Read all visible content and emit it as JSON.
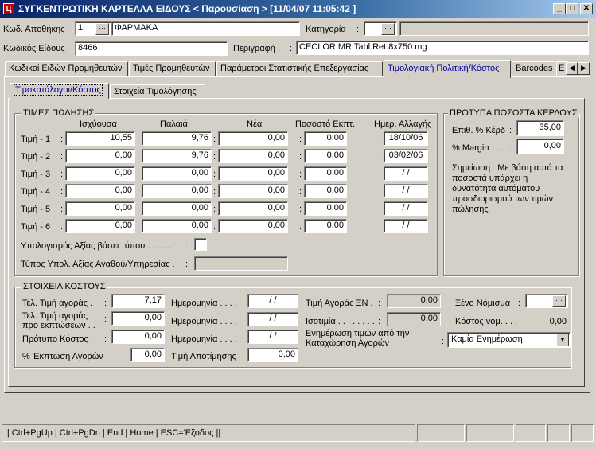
{
  "window": {
    "title": "ΣΥΓΚΕΝΤΡΩΤΙΚΗ ΚΑΡΤΕΛΛΑ ΕΙΔΟΥΣ < Παρουσίαση >   [11/04/07 11:05:42  ]",
    "minimize": "_",
    "maximize": "□",
    "close": "✕"
  },
  "header": {
    "warehouse_label": "Κωδ. Αποθήκης",
    "warehouse_code": "1",
    "warehouse_name": "ΦΑΡΜΑΚΑ",
    "category_label": "Κατηγορία",
    "category_value": "",
    "item_code_label": "Κωδικός Είδους",
    "item_code": "8466",
    "description_label": "Περιγραφή .",
    "description": "CECLOR MR Tabl.Ret.8x750 mg",
    "colon": ":"
  },
  "tabs": [
    {
      "label": "Κωδικοί Ειδών Προμηθευτών"
    },
    {
      "label": "Τιμές Προμηθευτών"
    },
    {
      "label": "Παράμετροι Στατιστικής Επεξεργασίας"
    },
    {
      "label": "Τιμολογιακή Πολιτική/Κόστος"
    },
    {
      "label": "Barcodes"
    },
    {
      "label": "E"
    }
  ],
  "subtabs": [
    {
      "label": "Τιμοκατάλογοι/Κόστος"
    },
    {
      "label": "Στοιχεία Τιμολόγησης"
    }
  ],
  "prices": {
    "group_title": "ΤΙΜΕΣ ΠΩΛΗΣΗΣ",
    "columns": [
      "Ισχύουσα",
      "Παλαιά",
      "Νέα",
      "Ποσοστό Εκπτ.",
      "Ημερ. Αλλαγής"
    ],
    "rows": [
      {
        "label": "Τιμή - 1",
        "current": "10,55",
        "old": "9,76",
        "new": "0,00",
        "disc": "0,00",
        "date": "18/10/06"
      },
      {
        "label": "Τιμή - 2",
        "current": "0,00",
        "old": "9,76",
        "new": "0,00",
        "disc": "0,00",
        "date": "03/02/06"
      },
      {
        "label": "Τιμή - 3",
        "current": "0,00",
        "old": "0,00",
        "new": "0,00",
        "disc": "0,00",
        "date": "/ /"
      },
      {
        "label": "Τιμή - 4",
        "current": "0,00",
        "old": "0,00",
        "new": "0,00",
        "disc": "0,00",
        "date": "/ /"
      },
      {
        "label": "Τιμή - 5",
        "current": "0,00",
        "old": "0,00",
        "new": "0,00",
        "disc": "0,00",
        "date": "/ /"
      },
      {
        "label": "Τιμή - 6",
        "current": "0,00",
        "old": "0,00",
        "new": "0,00",
        "disc": "0,00",
        "date": "/ /"
      }
    ],
    "calc_label": "Υπολογισμός Αξίας βάσει τύπου . . . . . .",
    "type_label": "Τύπος Υπολ. Αξίας Αγαθού/Υπηρεσίας .",
    "type_value": ""
  },
  "margins": {
    "group_title": "ΠΡΟΤΥΠΑ ΠΟΣΟΣΤΑ ΚΕΡΔΟΥΣ",
    "profit_label": "Επιθ. % Κέρδ",
    "profit_value": "35,00",
    "margin_label": "% Margin . . .",
    "margin_value": "0,00",
    "note": "Σημείωση : Με βάση αυτά τα ποσοστά υπάρχει η δυνατότητα αυτόματου προσδιορισμού των τιμών πώλησης"
  },
  "cost": {
    "group_title": "ΣΤΟΙΧΕΙΑ ΚΟΣΤΟΥΣ",
    "last_price_label": "Τελ. Τιμή αγοράς .",
    "last_price": "7,17",
    "last_price_predisc_label": "Τελ. Τιμή αγοράς προ εκπτώσεων . . .",
    "last_price_predisc": "0,00",
    "standard_cost_label": "Πρότυπο Κόστος .",
    "standard_cost": "0,00",
    "purchase_disc_label": "% Έκπτωση Αγορών",
    "purchase_disc": "0,00",
    "date_label": "Ημερομηνία . . . .",
    "date1": "/ /",
    "date2": "/ /",
    "date3": "/ /",
    "valuation_label": "Τιμή Αποτίμησης",
    "valuation": "0,00",
    "foreign_price_label": "Τιμή Αγοράς ΞΝ .",
    "foreign_price": "0,00",
    "parity_label": "Ισοτιμία . . . . . . . .",
    "parity": "0,00",
    "currency_label": "Ξένο Νόμισμα",
    "currency": "",
    "cost_nom_label": "Κόστος νομ. . . .",
    "cost_nom": "0,00",
    "update_label": "Ενημέρωση τιμών από την Καταχώρηση Αγορών",
    "update_value": "Καμία Ενημέρωση"
  },
  "status": {
    "keys": "|| Ctrl+PgUp | Ctrl+PgDn | End | Home | ESC='Εξοδος ||"
  },
  "icons": {
    "app": "app-logo-icon",
    "lookup": "ellipsis-icon",
    "dropdown": "chevron-down-icon"
  }
}
